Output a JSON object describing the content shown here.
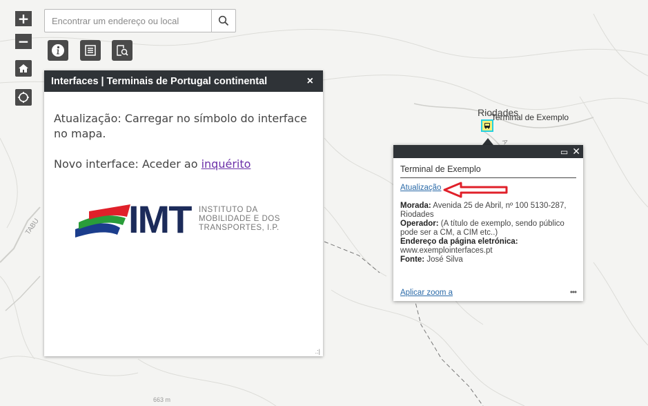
{
  "zoom": {
    "in_label": "+",
    "out_label": "−"
  },
  "search": {
    "placeholder": "Encontrar um endereço ou local"
  },
  "panel": {
    "title": "Interfaces | Terminais de Portugal continental",
    "close_label": "×",
    "update_text": "Atualização: Carregar no símbolo do interface no mapa.",
    "new_prefix": "Novo interface: Aceder ao ",
    "new_link": "inquérito",
    "logo_text": "IMT",
    "logo_lines": [
      "INSTITUTO DA",
      "MOBILIDADE E DOS",
      "TRANSPORTES, I.P."
    ]
  },
  "map": {
    "place_label": "Riodades",
    "terminal_label": "Terminal de Exemplo",
    "road_label_1": "TABU",
    "road_label_2": "A",
    "elevation_label": "663 m"
  },
  "popup": {
    "title": "Terminal de Exemplo",
    "link": "Atualização",
    "fields": [
      {
        "label": "Morada:",
        "value": "Avenida 25 de Abril, nº 100 5130-287, Riodades"
      },
      {
        "label": "Operador:",
        "value": "(A título de exemplo, sendo público pode ser a CM, a CIM etc..)"
      },
      {
        "label": "Endereço da página eletrónica:",
        "value": "www.exemplointerfaces.pt"
      },
      {
        "label": "Fonte:",
        "value": "José Silva"
      }
    ],
    "zoom_link": "Aplicar zoom a",
    "more_label": "•••"
  },
  "colors": {
    "header": "#2f3337",
    "arrow": "#e0202a",
    "link": "#2a6aa8"
  }
}
